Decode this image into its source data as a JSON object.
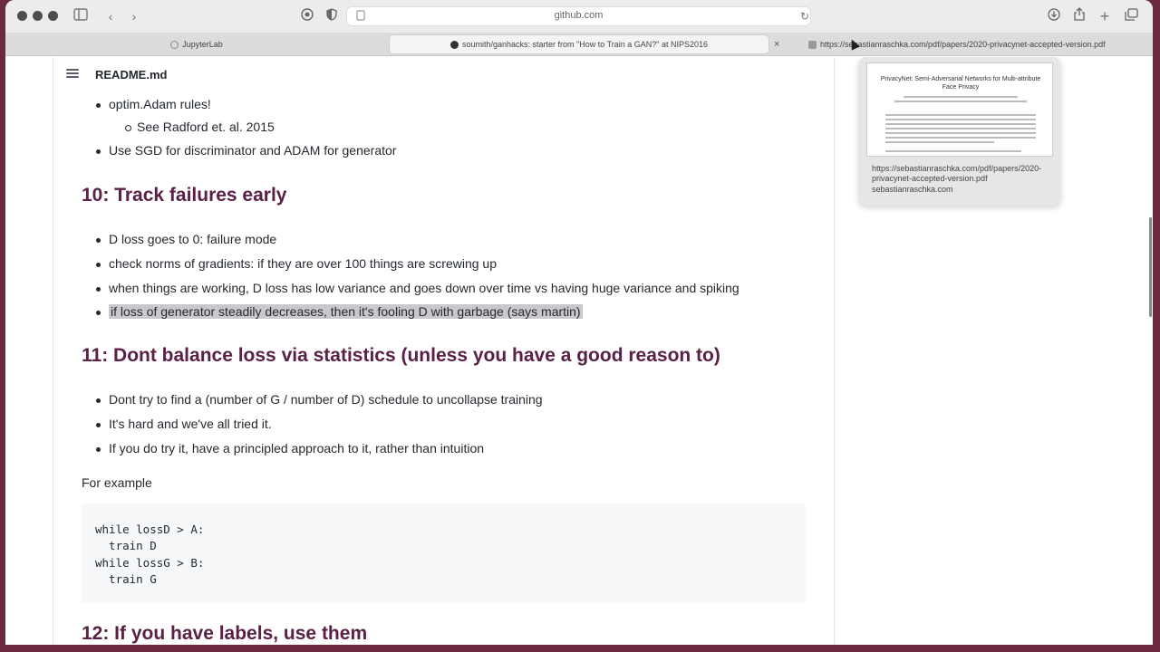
{
  "browser": {
    "address": "github.com",
    "tabs": [
      {
        "label": "JupyterLab"
      },
      {
        "label": "soumith/ganhacks: starter from \"How to Train a GAN?\" at NIPS2016"
      },
      {
        "label": "https://sebastianraschka.com/pdf/papers/2020-privacynet-accepted-version.pdf"
      }
    ],
    "tab_close": "×"
  },
  "readme": {
    "header": "README.md",
    "top_bullets": [
      "optim.Adam rules!",
      "Use SGD for discriminator and ADAM for generator"
    ],
    "sub_bullet": "See Radford et. al. 2015",
    "section10": {
      "title": "10: Track failures early",
      "bullets": [
        "D loss goes to 0: failure mode",
        "check norms of gradients: if they are over 100 things are screwing up",
        "when things are working, D loss has low variance and goes down over time vs having huge variance and spiking",
        "if loss of generator steadily decreases, then it's fooling D with garbage (says martin)"
      ]
    },
    "section11": {
      "title": "11: Dont balance loss via statistics (unless you have a good reason to)",
      "bullets": [
        "Dont try to find a (number of G / number of D) schedule to uncollapse training",
        "It's hard and we've all tried it.",
        "If you do try it, have a principled approach to it, rather than intuition"
      ],
      "for_example": "For example",
      "code": [
        "while lossD > A:",
        "  train D",
        "while lossG > B:",
        "  train G"
      ]
    },
    "section12": {
      "title": "12: If you have labels, use them"
    }
  },
  "preview": {
    "thumb_title": "PrivacyNet: Semi-Adversarial Networks for Multi-attribute Face Privacy",
    "url": "https://sebastianraschka.com/pdf/papers/2020-privacynet-accepted-version.pdf",
    "domain": "sebastianraschka.com"
  },
  "colors": {
    "heading": "#5a2046",
    "highlight": "#c9c9cd",
    "frame": "#6b2a3e"
  }
}
